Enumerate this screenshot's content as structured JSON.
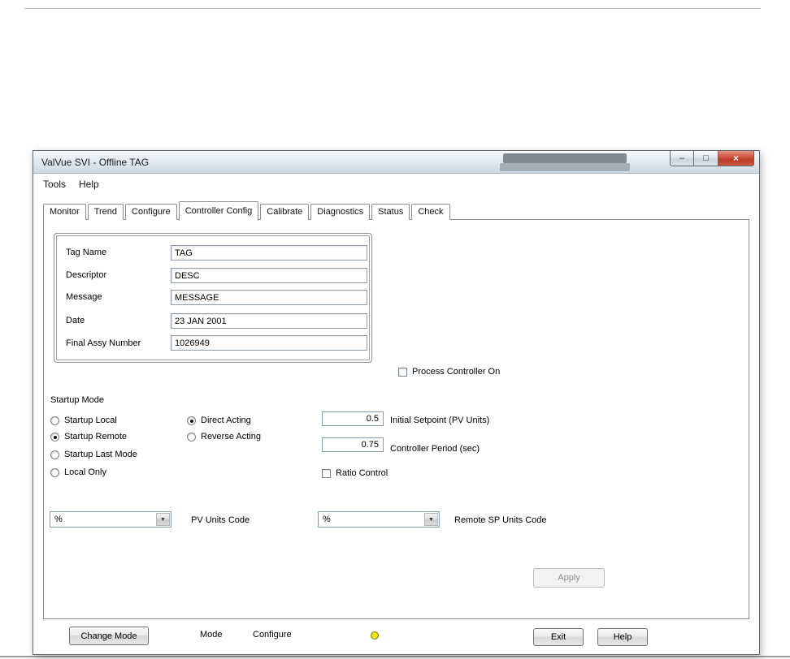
{
  "window": {
    "title": "ValVue SVI - Offline TAG",
    "menu": {
      "items": [
        "Tools",
        "Help"
      ]
    },
    "tabs": {
      "items": [
        "Monitor",
        "Trend",
        "Configure",
        "Controller Config",
        "Calibrate",
        "Diagnostics",
        "Status",
        "Check"
      ],
      "active": "Controller Config"
    }
  },
  "icons": {
    "minimize": "–",
    "maximize": "□",
    "close": "×",
    "combo_arrow": "▼"
  },
  "info_fields": [
    {
      "label": "Tag Name",
      "value": "TAG"
    },
    {
      "label": "Descriptor",
      "value": "DESC"
    },
    {
      "label": "Message",
      "value": "MESSAGE"
    },
    {
      "label": "Date",
      "value": "23 JAN 2001"
    },
    {
      "label": "Final Assy Number",
      "value": "1026949"
    }
  ],
  "process_controller": {
    "label": "Process Controller On",
    "checked": false
  },
  "startup_mode": {
    "label": "Startup Mode",
    "options": [
      {
        "label": "Startup Local",
        "selected": false
      },
      {
        "label": "Startup Remote",
        "selected": true
      },
      {
        "label": "Startup Last Mode",
        "selected": false
      },
      {
        "label": "Local Only",
        "selected": false
      }
    ]
  },
  "acting": {
    "options": [
      {
        "label": "Direct Acting",
        "selected": true
      },
      {
        "label": "Reverse Acting",
        "selected": false
      }
    ]
  },
  "inputs": {
    "initial_setpoint": {
      "value": "0.5",
      "label": "Initial Setpoint (PV Units)"
    },
    "controller_period": {
      "value": "0.75",
      "label": "Controller Period (sec)"
    }
  },
  "ratio_control": {
    "label": "Ratio Control",
    "checked": false
  },
  "pv_units": {
    "value": "%",
    "label": "PV Units Code"
  },
  "remote_sp_units": {
    "value": "%",
    "label": "Remote SP Units Code"
  },
  "buttons": {
    "apply": "Apply",
    "change_mode": "Change Mode",
    "exit": "Exit",
    "help": "Help"
  },
  "status": {
    "mode_label": "Mode",
    "mode_value": "Configure",
    "indicator_color": "#ffe600"
  }
}
